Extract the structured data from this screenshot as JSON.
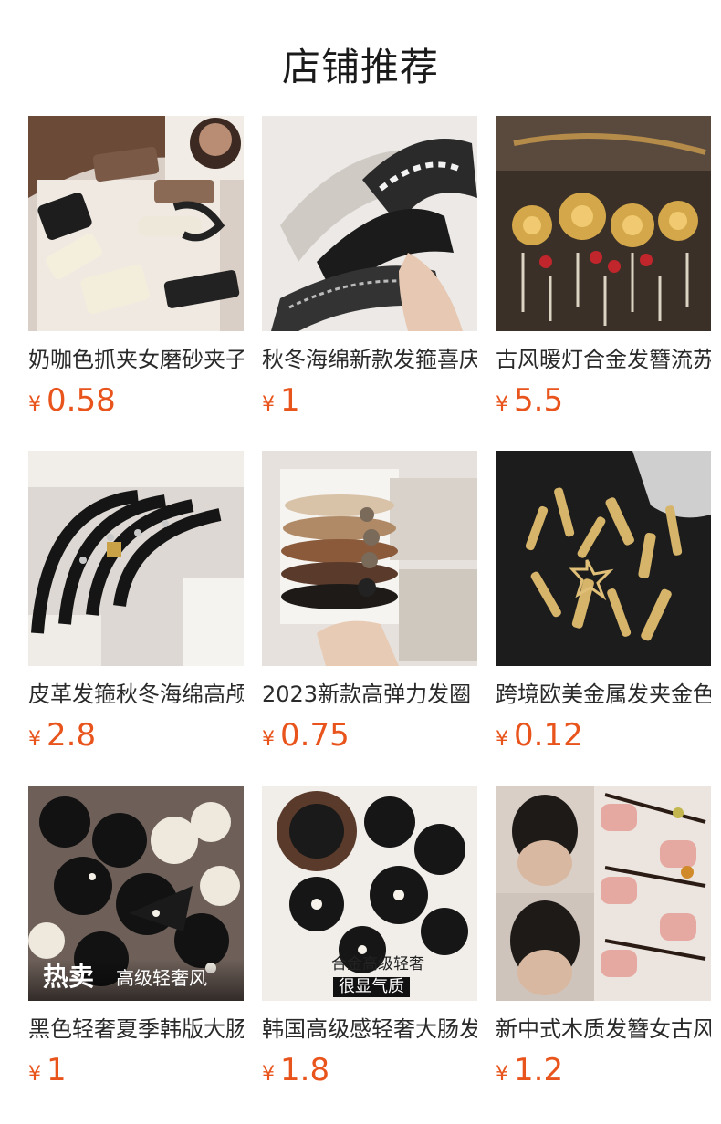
{
  "header": {
    "title": "店铺推荐"
  },
  "currency_symbol": "¥",
  "products": [
    {
      "name": "奶咖色抓夹女磨砂夹子",
      "price": "0.58",
      "image": "hair-claw-clips"
    },
    {
      "name": "秋冬海绵新款发箍喜庆",
      "price": "1",
      "image": "tweed-headbands"
    },
    {
      "name": "古风暖灯合金发簪流苏",
      "price": "5.5",
      "image": "gold-lantern-hairpin"
    },
    {
      "name": "皮革发箍秋冬海绵高颅顶",
      "price": "2.8",
      "image": "black-leather-headbands"
    },
    {
      "name": "2023新款高弹力发圈",
      "price": "0.75",
      "image": "scrunchie-set-card"
    },
    {
      "name": "跨境欧美金属发夹金色",
      "price": "0.12",
      "image": "gold-metal-hair-clips"
    },
    {
      "name": "黑色轻奢夏季韩版大肠发圈",
      "price": "1",
      "image": "black-bow-scrunchies",
      "overlay": {
        "hot": "热卖",
        "sub": "高级轻奢风"
      }
    },
    {
      "name": "韩国高级感轻奢大肠发圈",
      "price": "1.8",
      "image": "black-scrunchies-collection",
      "overlay": {
        "line1": "合金高级轻奢",
        "line2": "很显气质"
      }
    },
    {
      "name": "新中式木质发簪女古风",
      "price": "1.2",
      "image": "wooden-hairpins"
    }
  ]
}
